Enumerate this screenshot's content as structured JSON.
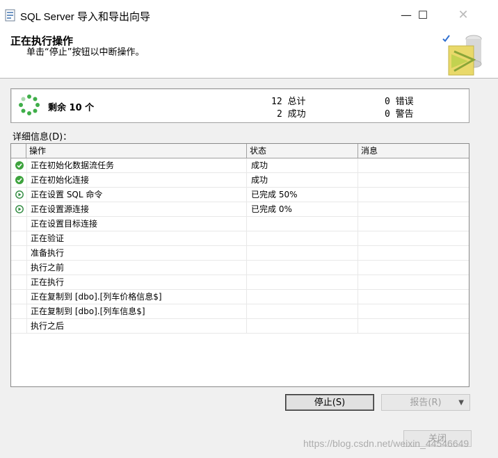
{
  "window": {
    "title": "SQL Server 导入和导出向导",
    "minimize": "—",
    "maximize": "☐",
    "close": "✕"
  },
  "header": {
    "title": "正在执行操作",
    "subtitle": "单击“停止”按钮以中断操作。"
  },
  "summary": {
    "remaining": "剩余 10 个",
    "total": "12 总计",
    "success": "2 成功",
    "errors": "0 错误",
    "warnings": "0 警告"
  },
  "details_label": "详细信息(D)：",
  "grid": {
    "columns": [
      "操作",
      "状态",
      "消息"
    ],
    "rows": [
      {
        "icon": "success-check-icon",
        "action": "正在初始化数据流任务",
        "status": "成功",
        "message": ""
      },
      {
        "icon": "success-check-icon",
        "action": "正在初始化连接",
        "status": "成功",
        "message": ""
      },
      {
        "icon": "in-progress-icon",
        "action": "正在设置 SQL 命令",
        "status": "已完成 50%",
        "message": ""
      },
      {
        "icon": "in-progress-icon",
        "action": "正在设置源连接",
        "status": "已完成 0%",
        "message": ""
      },
      {
        "icon": "",
        "action": "正在设置目标连接",
        "status": "",
        "message": ""
      },
      {
        "icon": "",
        "action": "正在验证",
        "status": "",
        "message": ""
      },
      {
        "icon": "",
        "action": "准备执行",
        "status": "",
        "message": ""
      },
      {
        "icon": "",
        "action": "执行之前",
        "status": "",
        "message": ""
      },
      {
        "icon": "",
        "action": "正在执行",
        "status": "",
        "message": ""
      },
      {
        "icon": "",
        "action": "正在复制到 [dbo].[列车价格信息$]",
        "status": "",
        "message": ""
      },
      {
        "icon": "",
        "action": "正在复制到 [dbo].[列车信息$]",
        "status": "",
        "message": ""
      },
      {
        "icon": "",
        "action": "执行之后",
        "status": "",
        "message": ""
      }
    ]
  },
  "buttons": {
    "stop": "停止(S)",
    "report": "报告(R)",
    "report_arrow": "▼",
    "close": "关闭"
  },
  "watermark": "https://blog.csdn.net/weixin_44546649",
  "colors": {
    "success": "#3ea33e",
    "progress": "#2e8a3e",
    "spinner": "#3fae49"
  }
}
